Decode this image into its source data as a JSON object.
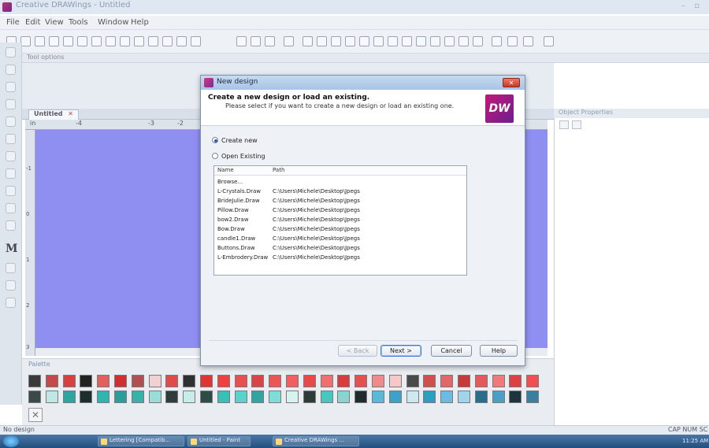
{
  "window": {
    "title": "Creative DRAWings - Untitled"
  },
  "menu": [
    "File",
    "Edit",
    "View",
    "Tools",
    "Window",
    "Help"
  ],
  "panels": {
    "tool_options": "Tool options",
    "document_tab": "Untitled",
    "object_properties": "Object Properties",
    "palette": "Palette"
  },
  "ruler": {
    "unit": "in",
    "ticks": [
      "-4",
      "-3",
      "-2"
    ],
    "vticks": [
      "-1",
      "0",
      "1",
      "2",
      "3"
    ]
  },
  "dialog": {
    "title": "New design",
    "heading": "Create a new design or load an existing.",
    "subheading": "Please select if you want to create a new design or load an existing one.",
    "logo_text": "DW",
    "options": [
      {
        "label": "Create new",
        "selected": true
      },
      {
        "label": "Open Existing",
        "selected": false
      }
    ],
    "columns": [
      "Name",
      "Path"
    ],
    "files": [
      {
        "name": "Browse...",
        "path": ""
      },
      {
        "name": "L-Crystals.Draw",
        "path": "C:\\Users\\Michele\\Desktop\\Jpegs"
      },
      {
        "name": "BrideJulie.Draw",
        "path": "C:\\Users\\Michele\\Desktop\\Jpegs"
      },
      {
        "name": "Pillow.Draw",
        "path": "C:\\Users\\Michele\\Desktop\\Jpegs"
      },
      {
        "name": "bow2.Draw",
        "path": "C:\\Users\\Michele\\Desktop\\Jpegs"
      },
      {
        "name": "Bow.Draw",
        "path": "C:\\Users\\Michele\\Desktop\\Jpegs"
      },
      {
        "name": "candle1.Draw",
        "path": "C:\\Users\\Michele\\Desktop\\Jpegs"
      },
      {
        "name": "Buttons.Draw",
        "path": "C:\\Users\\Michele\\Desktop\\Jpegs"
      },
      {
        "name": "L-Embrodery.Draw",
        "path": "C:\\Users\\Michele\\Desktop\\Jpegs"
      }
    ],
    "buttons": {
      "back": "< Back",
      "next": "Next >",
      "cancel": "Cancel",
      "help": "Help"
    }
  },
  "status": {
    "left": "No design",
    "right": "CAP NUM SC"
  },
  "taskbar": {
    "items": [
      "Lettering [Compatib...",
      "Untitled - Paint",
      "Creative DRAWings ..."
    ],
    "clock": "11:25 AM"
  },
  "colors": {
    "canvas": "#8f8ff2",
    "accent": "#2a5fae",
    "swatches_row1": [
      "#3a3a3a",
      "#c44a4a",
      "#d84040",
      "#222222",
      "#e06060",
      "#cc3030",
      "#b05050",
      "#f0d0d0",
      "#e24a4a",
      "#303030",
      "#e03535",
      "#f04040",
      "#e85050",
      "#d94545",
      "#ea5555",
      "#f06060",
      "#e84848",
      "#f07070",
      "#d83c3c",
      "#e55050",
      "#f08a8a",
      "#f6c8c8",
      "#4a4a4a",
      "#d05050",
      "#e06868",
      "#c83a3a",
      "#e45a5a",
      "#f07a7a",
      "#dc4040",
      "#f05050"
    ],
    "swatches_row2": [
      "#3a4a48",
      "#bfe8e4",
      "#2aa7a0",
      "#1e2e2c",
      "#30b5ae",
      "#2a9e98",
      "#3ab0a8",
      "#9adcd8",
      "#2e3c3a",
      "#c8ecea",
      "#2f4b48",
      "#35c0b8",
      "#5ad2cb",
      "#2fa6a0",
      "#7fdcd6",
      "#d8f2f0",
      "#2c3a38",
      "#4ac6be",
      "#8ad4d0",
      "#1f2c2a",
      "#5ab8d8",
      "#3aa4c8",
      "#cde8f0",
      "#2e9ec0",
      "#6abde0",
      "#9fd4ea",
      "#2a6e8c",
      "#4aa0c4",
      "#1e3440",
      "#3a7fa0"
    ]
  }
}
